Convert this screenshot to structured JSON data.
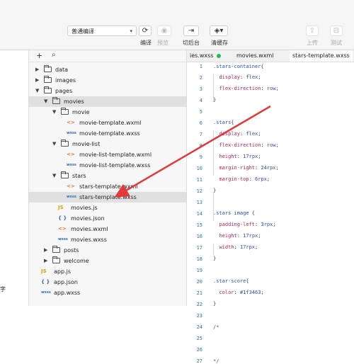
{
  "toolbar": {
    "compile_mode": "普通编译",
    "compile_label": "编译",
    "preview_label": "预览",
    "background_label": "切后台",
    "clear_cache_label": "清缓存",
    "upload_label": "上传",
    "test_label": "测试"
  },
  "left_edge_char": "字",
  "tabs": [
    {
      "label": "ies.wxss"
    },
    {
      "label": "movies.wxml"
    },
    {
      "label": "stars-template.wxss"
    }
  ],
  "tree": [
    {
      "name": "data",
      "kind": "folder",
      "depth": 0,
      "open": false
    },
    {
      "name": "images",
      "kind": "folder",
      "depth": 0,
      "open": false
    },
    {
      "name": "pages",
      "kind": "folder",
      "depth": 0,
      "open": true
    },
    {
      "name": "movies",
      "kind": "folder",
      "depth": 1,
      "open": true,
      "selected": true
    },
    {
      "name": "movie",
      "kind": "folder",
      "depth": 2,
      "open": true
    },
    {
      "name": "movie-template.wxml",
      "kind": "wxml",
      "depth": 3
    },
    {
      "name": "movie-template.wxss",
      "kind": "wxss",
      "depth": 3
    },
    {
      "name": "movie-list",
      "kind": "folder",
      "depth": 2,
      "open": true
    },
    {
      "name": "movie-list-template.wxml",
      "kind": "wxml",
      "depth": 3
    },
    {
      "name": "movie-list-template.wxss",
      "kind": "wxss",
      "depth": 3
    },
    {
      "name": "stars",
      "kind": "folder",
      "depth": 2,
      "open": true
    },
    {
      "name": "stars-template.wxml",
      "kind": "wxml",
      "depth": 3
    },
    {
      "name": "stars-template.wxss",
      "kind": "wxss",
      "depth": 3,
      "selected": true
    },
    {
      "name": "movies.js",
      "kind": "js",
      "depth": 2
    },
    {
      "name": "movies.json",
      "kind": "json",
      "depth": 2
    },
    {
      "name": "movies.wxml",
      "kind": "wxml",
      "depth": 2
    },
    {
      "name": "movies.wxss",
      "kind": "wxss",
      "depth": 2
    },
    {
      "name": "posts",
      "kind": "folder",
      "depth": 1,
      "open": false
    },
    {
      "name": "welcome",
      "kind": "folder",
      "depth": 1,
      "open": false
    },
    {
      "name": "app.js",
      "kind": "js",
      "depth": 0
    },
    {
      "name": "app.json",
      "kind": "json",
      "depth": 0
    },
    {
      "name": "app.wxss",
      "kind": "wxss",
      "depth": 0
    }
  ],
  "code_lines": [
    "1",
    "2",
    "3",
    "4",
    "5",
    "6",
    "7",
    "8",
    "9",
    "10",
    "11",
    "12",
    "13",
    "14",
    "15",
    "16",
    "17",
    "18",
    "19",
    "20",
    "21",
    "22",
    "23",
    "24",
    "25",
    "26",
    "27"
  ],
  "code": {
    "l1": ".stars-container{",
    "l2p": "display",
    "l2v": "flex",
    "l3p": "flex-direction",
    "l3v": "row",
    "l4": "}",
    "l7": ".stars{",
    "l8p": "display",
    "l8v": "flex",
    "l9p": "flex-direction",
    "l9v": "row",
    "l10p": "height",
    "l10v": "17rpx",
    "l11p": "margin-right",
    "l11v": "24rpx",
    "l12p": "margin-top",
    "l12v": "6rpx",
    "l13": "}",
    "l15": ".stars image {",
    "l16p": "padding-left",
    "l16v": "3rpx",
    "l17p": "height",
    "l17v": "17rpx",
    "l18p": "width",
    "l18v": "17rpx",
    "l19": "}",
    "l21": ".star-score{",
    "l22p": "color",
    "l22v": "#1f3463",
    "l23": "}",
    "l24": "/*",
    "l27": "*/"
  },
  "annotation_color": "#e03a3a"
}
